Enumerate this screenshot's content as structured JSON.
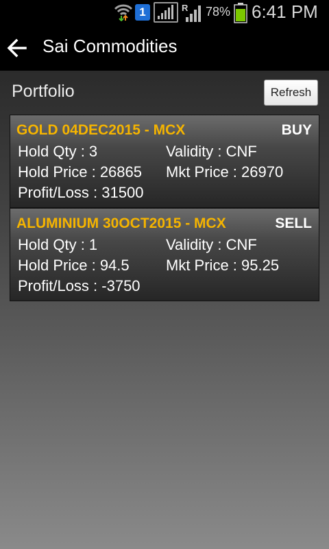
{
  "status_bar": {
    "notification_count": "1",
    "battery_level": "78%",
    "time": "6:41 PM",
    "icons": [
      "wifi-icon",
      "notification-icon",
      "signal-icon",
      "roaming-signal-icon",
      "battery-icon"
    ]
  },
  "action_bar": {
    "title": "Sai Commodities",
    "back_icon": "arrow-left-icon"
  },
  "page": {
    "title": "Portfolio",
    "refresh_label": "Refresh"
  },
  "positions": [
    {
      "symbol": "GOLD 04DEC2015 - MCX",
      "side": "BUY",
      "hold_qty": "Hold Qty : 3",
      "validity": "Validity : CNF",
      "hold_price": "Hold Price : 26865",
      "mkt_price": "Mkt Price : 26970",
      "profit_loss": "Profit/Loss : 31500"
    },
    {
      "symbol": "ALUMINIUM 30OCT2015 - MCX",
      "side": "SELL",
      "hold_qty": "Hold Qty : 1",
      "validity": "Validity : CNF",
      "hold_price": "Hold Price : 94.5",
      "mkt_price": "Mkt Price : 95.25",
      "profit_loss": "Profit/Loss : -3750"
    }
  ],
  "colors": {
    "symbol_accent": "#f5b400",
    "notification_badge": "#1f6fd6",
    "battery_fill": "#7cc800"
  }
}
